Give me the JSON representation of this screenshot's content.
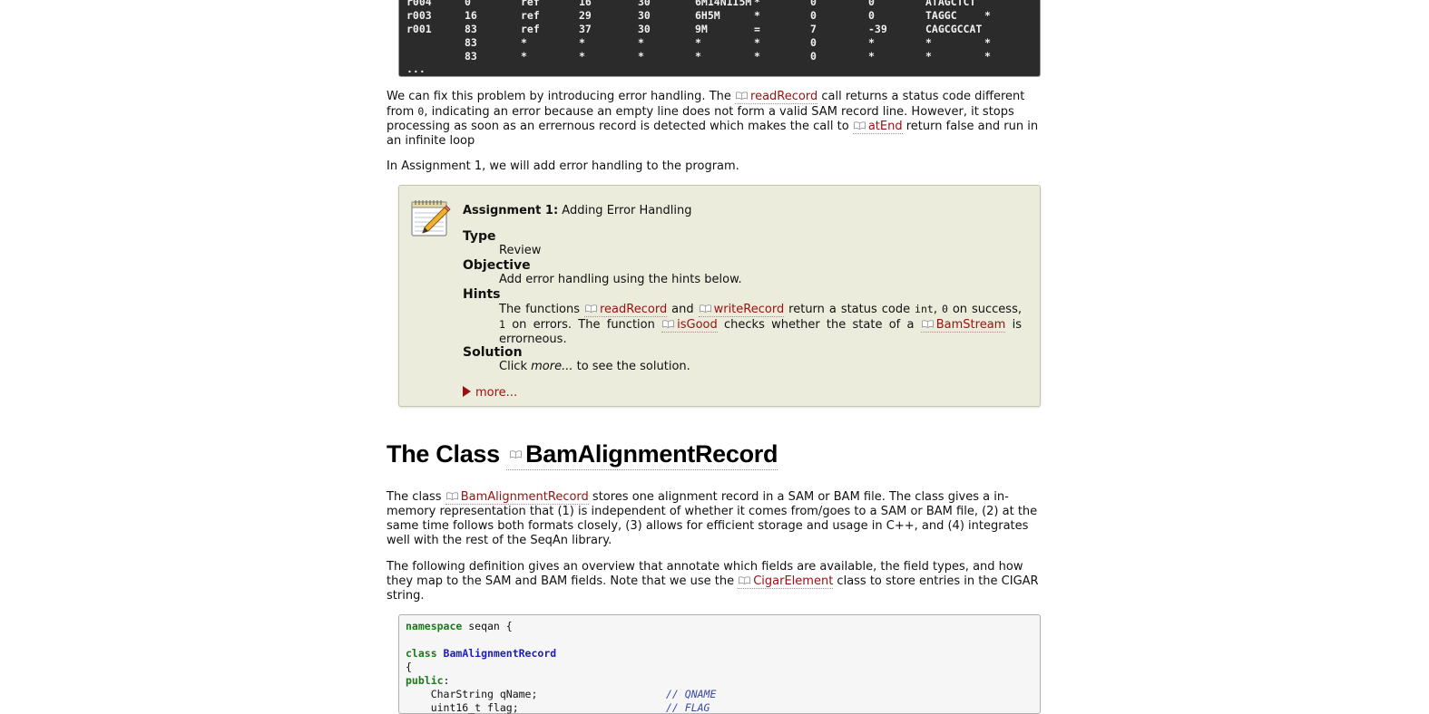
{
  "terminal": {
    "rows": [
      [
        "r004",
        "0",
        "ref",
        "16",
        "30",
        "6M14N1I5M",
        "*",
        "0",
        "0",
        "ATAGCTCT"
      ],
      [
        "r003",
        "16",
        "ref",
        "29",
        "30",
        "6H5M",
        "*",
        "0",
        "0",
        "TAGGC",
        "*"
      ],
      [
        "r001",
        "83",
        "ref",
        "37",
        "30",
        "9M",
        "=",
        "7",
        "-39",
        "CAGCGCCAT"
      ],
      [
        "",
        "83",
        "*",
        "*",
        "*",
        "*",
        "*",
        "0",
        "*",
        "*",
        "*"
      ],
      [
        "",
        "83",
        "*",
        "*",
        "*",
        "*",
        "*",
        "0",
        "*",
        "*",
        "*"
      ]
    ],
    "ellipsis": "..."
  },
  "para1": {
    "t1": "We can fix this problem by introducing error handling. The ",
    "ref1": "readRecord",
    "t2": " call returns a status code different from ",
    "code1": "0",
    "t3": ", indicating an error because an empty line does not form a valid SAM record line. However, it stops processing as soon as an errernous record is detected which makes the call to ",
    "ref2": "atEnd",
    "t4": " return false and run in an infinite loop"
  },
  "para2": "In Assignment 1, we will add error handling to the program.",
  "assignment": {
    "title_bold": "Assignment 1:",
    "title": " Adding Error Handling",
    "type_label": "Type",
    "type_value": "Review",
    "objective_label": "Objective",
    "objective_value": "Add error handling using the hints below.",
    "hints_label": "Hints",
    "hints": {
      "t1": "The functions ",
      "ref1": "readRecord",
      "t2": " and ",
      "ref2": "writeRecord",
      "t3": " return a status code ",
      "code1": "int",
      "t4": ", ",
      "code2": "0",
      "t5": " on success, ",
      "code3": "1",
      "t6": " on errors. The function ",
      "ref3": "isGood",
      "t7": " checks whether the state of a ",
      "ref4": "BamStream",
      "t8": " is errorneous."
    },
    "solution_label": "Solution",
    "solution": {
      "t1": "Click ",
      "em": "more...",
      "t2": " to see the solution."
    },
    "more_label": "more..."
  },
  "heading": {
    "prefix": "The Class ",
    "ref": "BamAlignmentRecord"
  },
  "para3": {
    "t1": "The class ",
    "ref1": "BamAlignmentRecord",
    "t2": " stores one alignment record in a SAM or BAM file. The class gives a in-memory representation that (1) is independent of whether it comes from/goes to a SAM or BAM file, (2) at the same time follows both formats closely, (3) allows for efficient storage and usage in C++, and (4) integrates well with the rest of the SeqAn library."
  },
  "para4": {
    "t1": "The following definition gives an overview that annotate which fields are available, the field types, and how they map to the SAM and BAM fields. Note that we use the ",
    "ref1": "CigarElement",
    "t2": " class to store entries in the CIGAR string."
  },
  "code": {
    "l1_kw": "namespace",
    "l1_rest": " seqan {",
    "l2_kw": "class",
    "l2_cls": " BamAlignmentRecord",
    "l3": "{",
    "l4_kw": "public",
    "l4_rest": ":",
    "l5_code": "    CharString qName;",
    "l5_cmt": "// QNAME",
    "l6_code": "    uint16_t flag;",
    "l6_cmt": "// FLAG"
  }
}
